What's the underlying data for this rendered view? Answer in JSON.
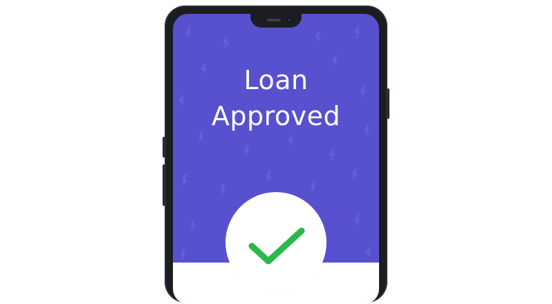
{
  "screen": {
    "title_line1": "Loan",
    "title_line2": "Approved"
  },
  "colors": {
    "screen_background": "#5751cf",
    "bolt_pattern": "#6a64d8",
    "phone_frame": "#1b1d20",
    "check_mark": "#2bb84a",
    "circle": "#ffffff"
  },
  "icons": {
    "status": "checkmark-icon",
    "pattern": "lightning-bolt-icon"
  }
}
